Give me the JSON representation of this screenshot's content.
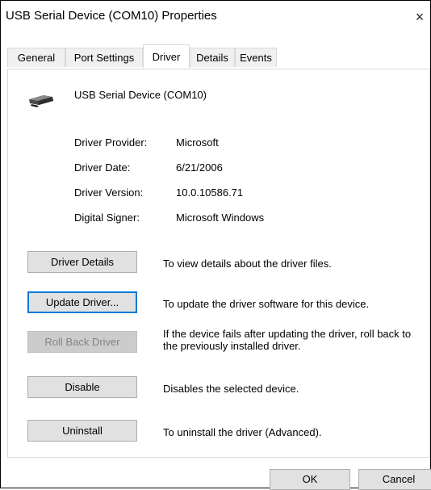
{
  "window": {
    "title": "USB Serial Device (COM10) Properties",
    "close_glyph": "×"
  },
  "tabs": [
    {
      "label": "General"
    },
    {
      "label": "Port Settings"
    },
    {
      "label": "Driver",
      "active": true
    },
    {
      "label": "Details"
    },
    {
      "label": "Events"
    }
  ],
  "device": {
    "name": "USB Serial Device (COM10)",
    "icon": "usb-serial-device-icon"
  },
  "properties": [
    {
      "label": "Driver Provider:",
      "value": "Microsoft"
    },
    {
      "label": "Driver Date:",
      "value": "6/21/2006"
    },
    {
      "label": "Driver Version:",
      "value": "10.0.10586.71"
    },
    {
      "label": "Digital Signer:",
      "value": "Microsoft Windows"
    }
  ],
  "actions": [
    {
      "label": "Driver Details",
      "description": "To view details about the driver files."
    },
    {
      "label": "Update Driver...",
      "description": "To update the driver software for this device."
    },
    {
      "label": "Roll Back Driver",
      "description": "If the device fails after updating the driver, roll back to the previously installed driver.",
      "disabled": true
    },
    {
      "label": "Disable",
      "description": "Disables the selected device."
    },
    {
      "label": "Uninstall",
      "description": "To uninstall the driver (Advanced)."
    }
  ],
  "footer": {
    "ok_label": "OK",
    "cancel_label": "Cancel"
  },
  "colors": {
    "focus_border": "#0078d7",
    "button_face": "#e1e1e1",
    "disabled_text": "#838383"
  }
}
